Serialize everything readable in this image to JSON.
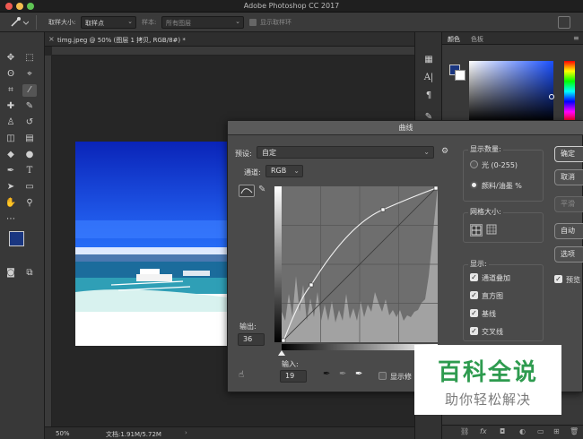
{
  "app": {
    "title": "Adobe Photoshop CC 2017"
  },
  "options_bar": {
    "sample_size_label": "取样大小:",
    "sample_size_value": "取样点",
    "sample_label": "样本:",
    "sample_value": "所有图层",
    "show_ring_label": "显示取样环"
  },
  "document": {
    "tab_title": "timg.jpeg @ 50% (图层 1 拷贝, RGB/8#) *",
    "zoom": "50%",
    "doc_info": "文档:1.91M/5.72M"
  },
  "right_panel": {
    "tab_color": "颜色",
    "tab_swatches": "色板",
    "foreground_color": "#1a3680",
    "background_color": "#ffffff"
  },
  "curves_dialog": {
    "title": "曲线",
    "preset_label": "预设:",
    "preset_value": "自定",
    "channel_label": "通道:",
    "channel_value": "RGB",
    "output_label": "输出:",
    "output_value": "36",
    "input_label": "输入:",
    "input_value": "19",
    "show_clipping_label": "显示修",
    "display_amount": {
      "title": "显示数量:",
      "light_label": "光 (0-255)",
      "pigment_label": "颜料/油墨 %"
    },
    "grid_size": {
      "title": "网格大小:"
    },
    "display": {
      "title": "显示:",
      "options": [
        "通道叠加",
        "直方图",
        "基线",
        "交叉线"
      ]
    },
    "buttons": {
      "ok": "确定",
      "cancel": "取消",
      "smooth": "平滑",
      "auto": "自动",
      "options": "选项"
    },
    "preview_label": "预览"
  },
  "watermark": {
    "title": "百科全说",
    "subtitle": "助你轻松解决",
    "title_color": "#2e9b4f"
  }
}
